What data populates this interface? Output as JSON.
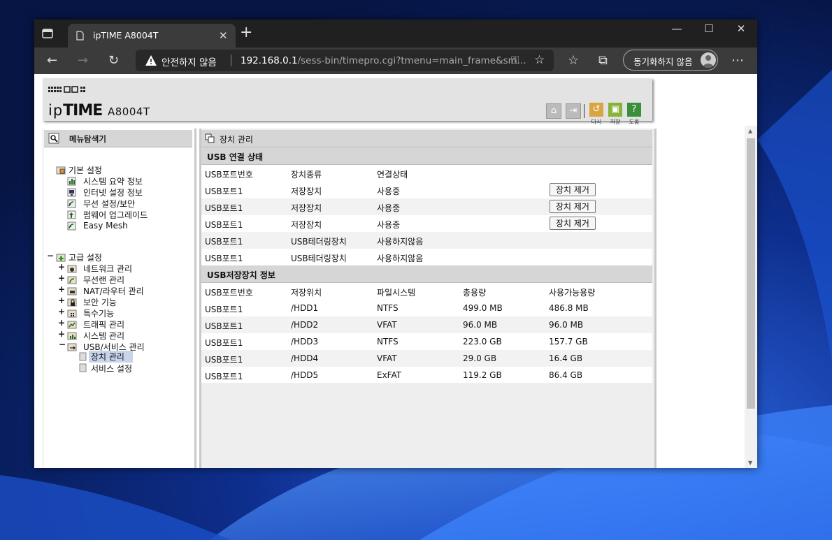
{
  "browser": {
    "tab_title": "ipTIME A8004T",
    "address_security": "안전하지 않음",
    "address_host": "192.168.0.1",
    "address_path": "/sess-bin/timepro.cgi?tmenu=main_frame&sm...",
    "sync_label": "동기화하지 않음"
  },
  "router": {
    "brand": "ipTIME",
    "brand_prefix": "ip",
    "brand_main": "TIME",
    "model": "A8004T",
    "header_buttons": [
      {
        "label": "다시",
        "color": "#d9a441"
      },
      {
        "label": "저장",
        "color": "#86b33a"
      },
      {
        "label": "도움",
        "color": "#3a8f3a"
      }
    ]
  },
  "menu": {
    "title": "메뉴탐색기",
    "basic": {
      "label": "기본 설정",
      "items": [
        "시스템 요약 정보",
        "인터넷 설정 정보",
        "무선 설정/보안",
        "펌웨어 업그레이드",
        "Easy Mesh"
      ]
    },
    "advanced": {
      "label": "고급 설정",
      "items": [
        "네트워크 관리",
        "무선랜 관리",
        "NAT/라우터 관리",
        "보안 기능",
        "특수기능",
        "트래픽 관리",
        "시스템 관리",
        "USB/서비스 관리"
      ],
      "usb_sub": [
        "장치 관리",
        "서비스 설정"
      ]
    }
  },
  "main": {
    "title": "장치 관리",
    "conn_section": "USB 연결 상태",
    "conn_headers": [
      "USB포트번호",
      "장치종류",
      "연결상태"
    ],
    "conn_rows": [
      {
        "port": "USB포트1",
        "type": "저장장치",
        "status": "사용중",
        "button": "장치 제거"
      },
      {
        "port": "USB포트1",
        "type": "저장장치",
        "status": "사용중",
        "button": "장치 제거"
      },
      {
        "port": "USB포트1",
        "type": "저장장치",
        "status": "사용중",
        "button": "장치 제거"
      },
      {
        "port": "USB포트1",
        "type": "USB테더링장치",
        "status": "사용하지않음",
        "button": ""
      },
      {
        "port": "USB포트1",
        "type": "USB테더링장치",
        "status": "사용하지않음",
        "button": ""
      }
    ],
    "storage_section": "USB저장장치 정보",
    "storage_headers": [
      "USB포트번호",
      "저장위치",
      "파일시스템",
      "총용량",
      "사용가능용량"
    ],
    "storage_rows": [
      {
        "port": "USB포트1",
        "loc": "/HDD1",
        "fs": "NTFS",
        "total": "499.0 MB",
        "free": "486.8 MB"
      },
      {
        "port": "USB포트1",
        "loc": "/HDD2",
        "fs": "VFAT",
        "total": "96.0 MB",
        "free": "96.0 MB"
      },
      {
        "port": "USB포트1",
        "loc": "/HDD3",
        "fs": "NTFS",
        "total": "223.0 GB",
        "free": "157.7 GB"
      },
      {
        "port": "USB포트1",
        "loc": "/HDD4",
        "fs": "VFAT",
        "total": "29.0 GB",
        "free": "16.4 GB"
      },
      {
        "port": "USB포트1",
        "loc": "/HDD5",
        "fs": "ExFAT",
        "total": "119.2 GB",
        "free": "86.4 GB"
      }
    ]
  }
}
